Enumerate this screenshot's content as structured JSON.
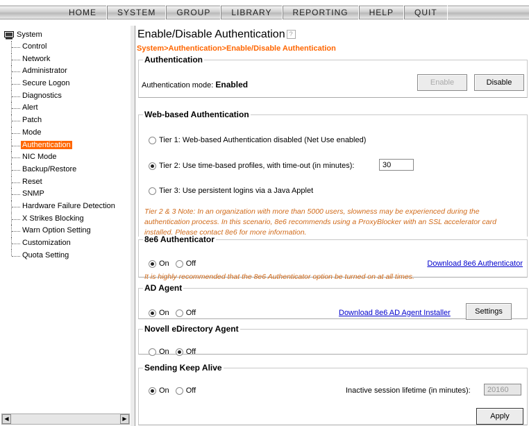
{
  "nav": {
    "items": [
      "HOME",
      "SYSTEM",
      "GROUP",
      "LIBRARY",
      "REPORTING",
      "HELP",
      "QUIT"
    ]
  },
  "sidebar": {
    "root_label": "System",
    "items": [
      "Control",
      "Network",
      "Administrator",
      "Secure Logon",
      "Diagnostics",
      "Alert",
      "Patch",
      "Mode",
      "Authentication",
      "NIC Mode",
      "Backup/Restore",
      "Reset",
      "SNMP",
      "Hardware Failure Detection",
      "X Strikes Blocking",
      "Warn Option Setting",
      "Customization",
      "Quota Setting"
    ],
    "selected": "Authentication"
  },
  "main": {
    "title": "Enable/Disable Authentication",
    "breadcrumb": "System>Authentication>Enable/Disable Authentication",
    "auth": {
      "legend": "Authentication",
      "mode_label": "Authentication mode:",
      "mode_value": "Enabled",
      "enable_label": "Enable",
      "disable_label": "Disable"
    },
    "web": {
      "legend": "Web-based Authentication",
      "tier1": "Tier 1: Web-based Authentication disabled (Net Use enabled)",
      "tier2": "Tier 2: Use time-based profiles, with time-out (in minutes):",
      "tier2_value": "30",
      "tier3": "Tier 3: Use persistent logins via a Java Applet",
      "selected": "tier2"
    },
    "note": "Tier 2 & 3 Note: In an organization with more than 5000 users, slowness may be experienced during the authentication process.  In this scenario, 8e6 recommends using a ProxyBlocker with an SSL accelerator card installed.  Please contact 8e6 for more information.",
    "authenticator": {
      "legend": "8e6 Authenticator",
      "on_label": "On",
      "off_label": "Off",
      "selected": "On",
      "download_link": "Download 8e6 Authenticator",
      "warning": "It is highly recommended that the 8e6 Authenticator option be turned on at all times."
    },
    "ad_agent": {
      "legend": "AD Agent",
      "on_label": "On",
      "off_label": "Off",
      "selected": "On",
      "download_link": "Download 8e6 AD Agent Installer",
      "settings_label": "Settings"
    },
    "novell": {
      "legend": "Novell eDirectory Agent",
      "on_label": "On",
      "off_label": "Off",
      "selected": "Off"
    },
    "keepalive": {
      "legend": "Sending Keep Alive",
      "on_label": "On",
      "off_label": "Off",
      "selected": "On",
      "lifetime_label": "Inactive session lifetime (in minutes):",
      "lifetime_value": "20160"
    },
    "apply_label": "Apply"
  }
}
